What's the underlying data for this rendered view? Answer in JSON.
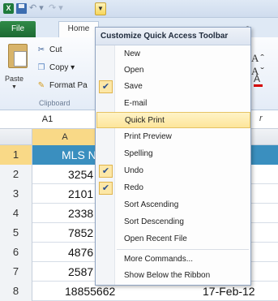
{
  "qat": {
    "app_logo": "X"
  },
  "tabs": {
    "file": "File",
    "home": "Home",
    "tail": "s"
  },
  "ribbon": {
    "paste": "Paste",
    "cut": "Cut",
    "copy": "Copy",
    "format_painter": "Format Pa",
    "clipboard_group": "Clipboard",
    "font_grow": "Aˆ Aˇ",
    "font_color": "A"
  },
  "formula_bar": {
    "name_box": "A1",
    "fx_tail": "r"
  },
  "columns": {
    "a_header": "A"
  },
  "rows": [
    {
      "num": "1",
      "a": "MLS N",
      "b": ""
    },
    {
      "num": "2",
      "a": "3254",
      "b": ""
    },
    {
      "num": "3",
      "a": "2101",
      "b": ""
    },
    {
      "num": "4",
      "a": "2338",
      "b": ""
    },
    {
      "num": "5",
      "a": "7852",
      "b": ""
    },
    {
      "num": "6",
      "a": "4876",
      "b": ""
    },
    {
      "num": "7",
      "a": "2587",
      "b": ""
    },
    {
      "num": "8",
      "a": "18855662",
      "b": "17-Feb-12"
    }
  ],
  "menu": {
    "title": "Customize Quick Access Toolbar",
    "items": [
      {
        "label": "New",
        "checked": false
      },
      {
        "label": "Open",
        "checked": false
      },
      {
        "label": "Save",
        "checked": true
      },
      {
        "label": "E-mail",
        "checked": false
      },
      {
        "label": "Quick Print",
        "checked": false,
        "highlighted": true
      },
      {
        "label": "Print Preview",
        "checked": false
      },
      {
        "label": "Spelling",
        "checked": false
      },
      {
        "label": "Undo",
        "checked": true
      },
      {
        "label": "Redo",
        "checked": true
      },
      {
        "label": "Sort Ascending",
        "checked": false
      },
      {
        "label": "Sort Descending",
        "checked": false
      },
      {
        "label": "Open Recent File",
        "checked": false
      }
    ],
    "more_commands": "More Commands...",
    "show_below": "Show Below the Ribbon",
    "check_glyph": "✔"
  },
  "colors": {
    "excel_green": "#1f7a3c",
    "header_blue": "#3a8fbf",
    "highlight": "#fde59a"
  }
}
